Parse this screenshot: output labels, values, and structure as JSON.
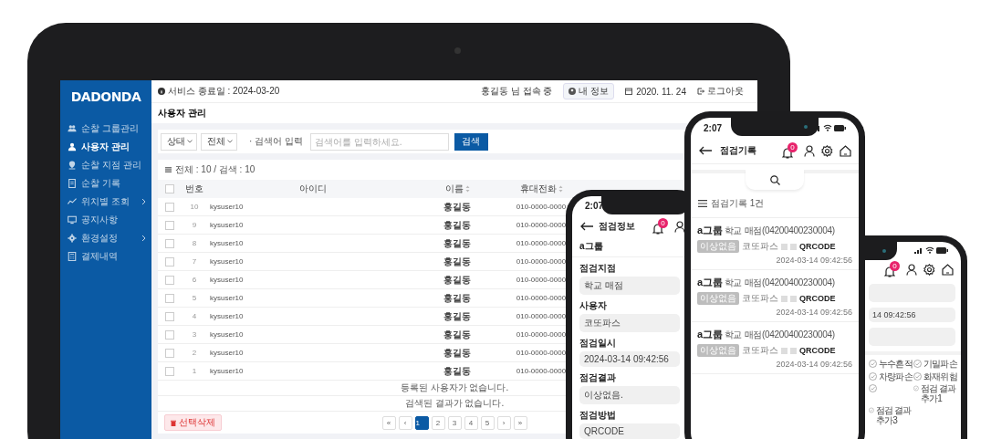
{
  "tablet": {
    "logo": "DADONDA",
    "sidebar": {
      "items": [
        {
          "label": "순찰 그룹관리",
          "selected": false,
          "expandable": false
        },
        {
          "label": "사용자 관리",
          "selected": true,
          "expandable": false
        },
        {
          "label": "순찰 지점 관리",
          "selected": false,
          "expandable": false
        },
        {
          "label": "순찰 기록",
          "selected": false,
          "expandable": false
        },
        {
          "label": "위치별 조회",
          "selected": false,
          "expandable": true
        },
        {
          "label": "공지사항",
          "selected": false,
          "expandable": false
        },
        {
          "label": "환경설정",
          "selected": false,
          "expandable": true
        },
        {
          "label": "결제내역",
          "selected": false,
          "expandable": false
        }
      ]
    },
    "header": {
      "service_end": "서비스 종료일 : 2024-03-20",
      "user": "홍길동 님 접속 중",
      "my_info_button": "내 정보",
      "date": "2020. 11. 24",
      "logout": "로그아웃"
    },
    "page_title": "사용자 관리",
    "filter": {
      "status_select": "상태",
      "type_select": "전체",
      "search_label": "· 검색어 입력",
      "search_field": {
        "placeholder": "검색어를 입력하세요."
      },
      "search_button": "검색"
    },
    "list": {
      "summary": "전체 : 10 / 검색 : 10",
      "select_all_checked": false,
      "columns": [
        {
          "label": "번호",
          "sortable": false
        },
        {
          "label": "아이디",
          "sortable": false
        },
        {
          "label": "이름",
          "sortable": true
        },
        {
          "label": "휴대전화",
          "sortable": true
        }
      ],
      "rows": [
        {
          "number": "10",
          "id": "kysuser10",
          "name": "홍길동",
          "phone": "010-0000-0000",
          "checked": false
        },
        {
          "number": "9",
          "id": "kysuser10",
          "name": "홍길동",
          "phone": "010-0000-0000",
          "checked": false
        },
        {
          "number": "8",
          "id": "kysuser10",
          "name": "홍길동",
          "phone": "010-0000-0000",
          "checked": false
        },
        {
          "number": "7",
          "id": "kysuser10",
          "name": "홍길동",
          "phone": "010-0000-0000",
          "checked": false
        },
        {
          "number": "6",
          "id": "kysuser10",
          "name": "홍길동",
          "phone": "010-0000-0000",
          "checked": false
        },
        {
          "number": "5",
          "id": "kysuser10",
          "name": "홍길동",
          "phone": "010-0000-0000",
          "checked": false
        },
        {
          "number": "4",
          "id": "kysuser10",
          "name": "홍길동",
          "phone": "010-0000-0000",
          "checked": false
        },
        {
          "number": "3",
          "id": "kysuser10",
          "name": "홍길동",
          "phone": "010-0000-0000",
          "checked": false
        },
        {
          "number": "2",
          "id": "kysuser10",
          "name": "홍길동",
          "phone": "010-0000-0000",
          "checked": false
        },
        {
          "number": "1",
          "id": "kysuser10",
          "name": "홍길동",
          "phone": "010-0000-0000",
          "checked": false
        }
      ],
      "messages": [
        "등록된 사용자가 없습니다.",
        "검색된 결과가 없습니다."
      ],
      "delete_button": "선택삭제",
      "pagination": [
        {
          "label": "«",
          "selected": false
        },
        {
          "label": "‹",
          "selected": false
        },
        {
          "label": "1",
          "selected": true
        },
        {
          "label": "2",
          "selected": false
        },
        {
          "label": "3",
          "selected": false
        },
        {
          "label": "4",
          "selected": false
        },
        {
          "label": "5",
          "selected": false
        },
        {
          "label": "›",
          "selected": false
        },
        {
          "label": "»",
          "selected": false
        }
      ]
    }
  },
  "phone_detail": {
    "time": "2:07",
    "title": "점검정보",
    "notification_count": "0",
    "group": "a그룹",
    "fields": [
      {
        "label": "점검지점",
        "value": "학교 매점"
      },
      {
        "label": "사용자",
        "value": "코또파스"
      },
      {
        "label": "점검일시",
        "value": "2024-03-14 09:42:56"
      },
      {
        "label": "점검결과",
        "value": "이상없음."
      },
      {
        "label": "점검방법",
        "value": "QRCODE"
      }
    ]
  },
  "phone_list": {
    "time": "2:07",
    "title": "점검기록",
    "notification_count": "0",
    "count_label": "점검기록 1건",
    "records": [
      {
        "group": "a그룹",
        "place": "학교 매점(04200400230004)",
        "status": "이상없음",
        "user": "코또파스",
        "method": "QRCODE",
        "datetime": "2024-03-14 09:42:56"
      },
      {
        "group": "a그룹",
        "place": "학교 매점(04200400230004)",
        "status": "이상없음",
        "user": "코또파스",
        "method": "QRCODE",
        "datetime": "2024-03-14 09:42:56"
      },
      {
        "group": "a그룹",
        "place": "학교 매점(04200400230004)",
        "status": "이상없음",
        "user": "코또파스",
        "method": "QRCODE",
        "datetime": "2024-03-14 09:42:56"
      }
    ]
  },
  "phone_check": {
    "notification_count": "0",
    "fields": [
      {
        "kind": "empty"
      },
      {
        "kind": "text",
        "value": "14 09:42:56"
      },
      {
        "kind": "empty"
      }
    ],
    "checklist": [
      {
        "kind": "labeled",
        "label": "누수흔적"
      },
      {
        "kind": "labeled",
        "label": "기밀파손"
      },
      {
        "kind": "labeled",
        "label": "차량파손"
      },
      {
        "kind": "labeled",
        "label": "화재위험"
      },
      {
        "kind": "unlabeled"
      },
      {
        "kind": "labeled",
        "label": "점검 결과 추가1"
      },
      {
        "kind": "labeled",
        "label": "점검 결과 추가3"
      }
    ]
  }
}
